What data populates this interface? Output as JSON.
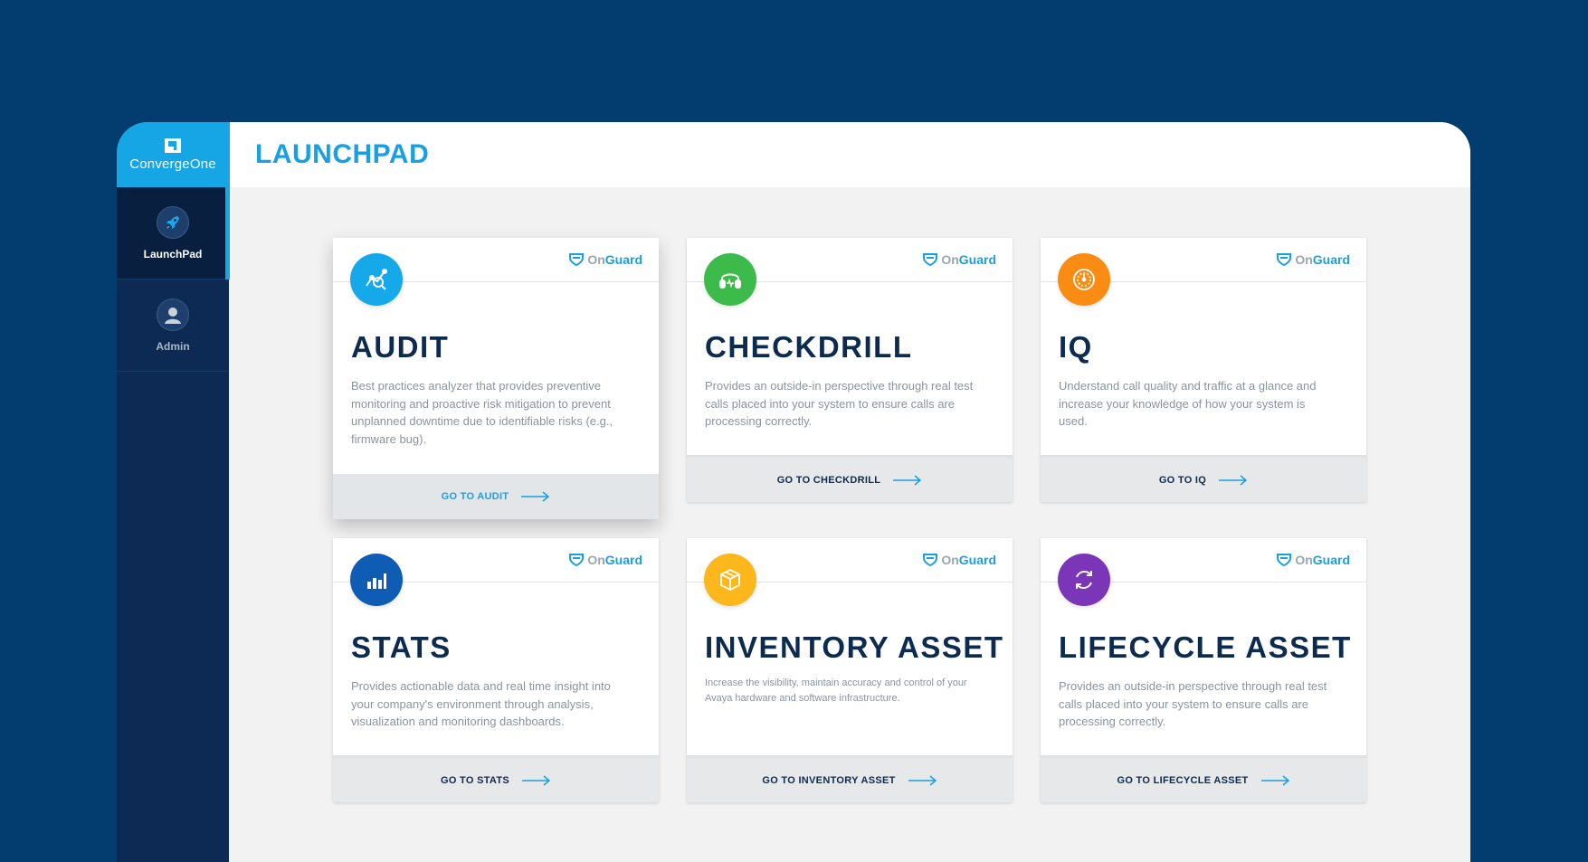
{
  "brand": {
    "name": "ConvergeOne"
  },
  "sidebar": {
    "items": [
      {
        "label": "LaunchPad",
        "icon": "rocket-icon",
        "active": true
      },
      {
        "label": "Admin",
        "icon": "user-icon",
        "active": false
      }
    ]
  },
  "header": {
    "title": "LAUNCHPAD"
  },
  "onguard": {
    "prefix": "On",
    "suffix": "Guard"
  },
  "cards": [
    {
      "title": "AUDIT",
      "icon": "audit-analyzer-icon",
      "color": "#16a9ea",
      "description": "Best practices analyzer that provides preventive monitoring and proactive risk mitigation to prevent unplanned downtime due to identifiable risks (e.g., firmware bug).",
      "cta": "GO TO AUDIT"
    },
    {
      "title": "CHECKDRILL",
      "icon": "headset-icon",
      "color": "#3dbb4a",
      "description": "Provides an outside-in perspective through real test calls placed into your system to ensure calls are processing correctly.",
      "cta": "GO TO CHECKDRILL"
    },
    {
      "title": "IQ",
      "icon": "gauge-icon",
      "color": "#fb8c13",
      "description": "Understand call quality and traffic at a glance and increase your knowledge of how your system is used.",
      "cta": "GO TO IQ"
    },
    {
      "title": "STATS",
      "icon": "bar-chart-icon",
      "color": "#0f5cb5",
      "description": "Provides actionable data and real time insight into your company's environment through analysis, visualization and monitoring dashboards.",
      "cta": "GO TO STATS"
    },
    {
      "title": "INVENTORY ASSET",
      "icon": "box-icon",
      "color": "#fbb71b",
      "description": "Increase the visibility, maintain accuracy and control of your Avaya hardware and software infrastructure.",
      "cta": "GO TO INVENTORY ASSET"
    },
    {
      "title": "LIFECYCLE ASSET",
      "icon": "refresh-cycle-icon",
      "color": "#7b35b7",
      "description": "Provides an outside-in perspective through real test calls placed into your system to ensure calls are processing correctly.",
      "cta": "GO TO LIFECYCLE ASSET"
    }
  ]
}
